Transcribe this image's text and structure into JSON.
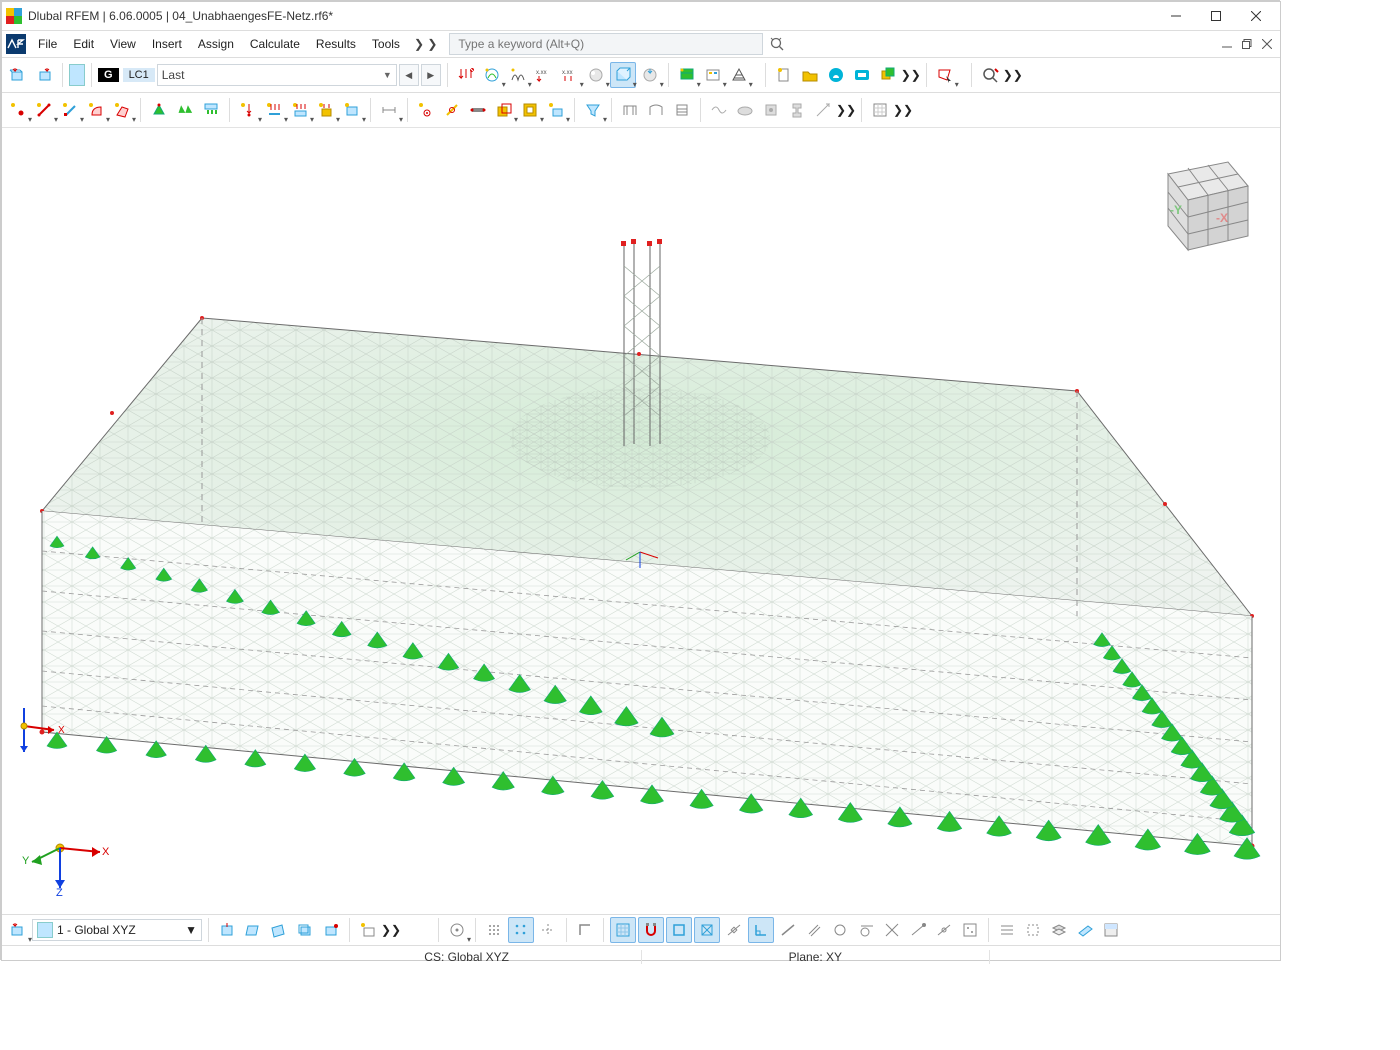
{
  "window": {
    "title": "Dlubal RFEM | 6.06.0005 | 04_UnabhaengesFE-Netz.rf6*"
  },
  "menu": {
    "items": [
      "File",
      "Edit",
      "View",
      "Insert",
      "Assign",
      "Calculate",
      "Results",
      "Tools"
    ],
    "more": "❯ ❯"
  },
  "search": {
    "placeholder": "Type a keyword (Alt+Q)"
  },
  "loadcase": {
    "chip": "G",
    "id": "LC1",
    "name": "Last"
  },
  "cs_select": {
    "label": "1 - Global XYZ"
  },
  "status": {
    "cs": "CS: Global XYZ",
    "plane": "Plane: XY"
  },
  "axes": {
    "x": "X",
    "y": "Y",
    "z": "Z"
  },
  "cube": {
    "x": "-X",
    "y": "-Y"
  },
  "colors": {
    "mesh": "#b9c7bb",
    "mesh_dark": "#8f9d91",
    "support": "#2fbf2f",
    "node": "#e02020",
    "axis_x": "#d80000",
    "axis_y": "#20a020",
    "axis_z": "#1040e0",
    "accent": "#2fa0d8"
  }
}
